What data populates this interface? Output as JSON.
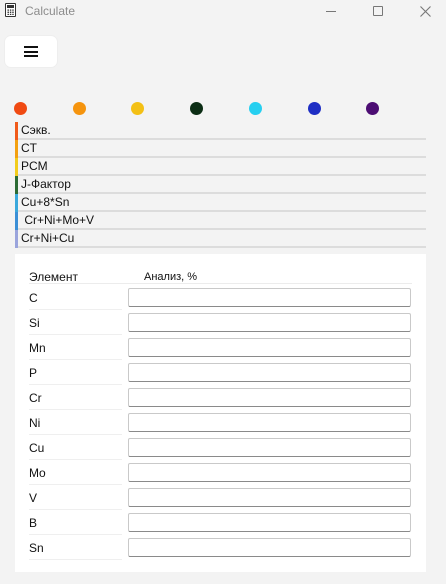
{
  "window": {
    "title": "Calculate",
    "icon": "calculator-icon",
    "controls": [
      "minimize-icon",
      "maximize-icon",
      "close-icon"
    ]
  },
  "menu": {
    "icon": "hamburger-menu-icon"
  },
  "dots": [
    {
      "color": "#f04a12"
    },
    {
      "color": "#f5940e"
    },
    {
      "color": "#f3c015"
    },
    {
      "color": "#0b2d14"
    },
    {
      "color": "#26cff0"
    },
    {
      "color": "#1e2ec4"
    },
    {
      "color": "#4c0d73"
    }
  ],
  "indices": [
    {
      "label": "Сэкв.",
      "color": "#f05a1a"
    },
    {
      "label": "CT",
      "color": "#f3a010"
    },
    {
      "label": "PCM",
      "color": "#f2cc1c"
    },
    {
      "label": "J-Фактор",
      "color": "#2c6b34"
    },
    {
      "label": "Cu+8*Sn",
      "color": "#3aa8dc"
    },
    {
      "label": " Cr+Ni+Mo+V",
      "color": "#3b8fd6"
    },
    {
      "label": "Cr+Ni+Cu",
      "color": "#9aa4dc"
    }
  ],
  "table": {
    "header_element": "Элемент",
    "header_analysis": "Анализ, %",
    "rows": [
      {
        "element": "C",
        "value": ""
      },
      {
        "element": "Si",
        "value": ""
      },
      {
        "element": "Mn",
        "value": ""
      },
      {
        "element": "P",
        "value": ""
      },
      {
        "element": "Cr",
        "value": ""
      },
      {
        "element": "Ni",
        "value": ""
      },
      {
        "element": "Cu",
        "value": ""
      },
      {
        "element": "Mo",
        "value": ""
      },
      {
        "element": "V",
        "value": ""
      },
      {
        "element": "B",
        "value": ""
      },
      {
        "element": "Sn",
        "value": ""
      }
    ]
  }
}
